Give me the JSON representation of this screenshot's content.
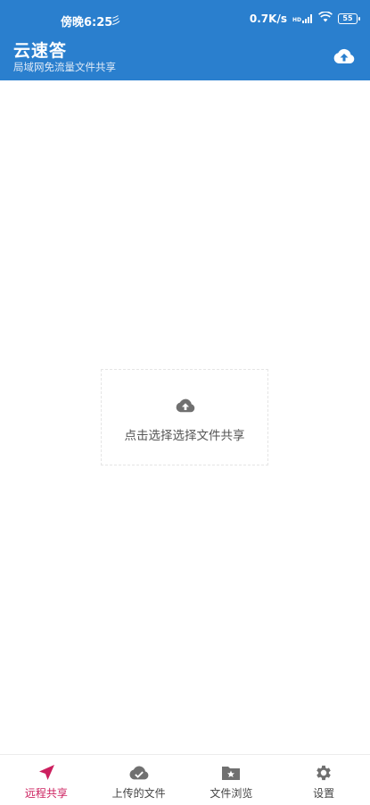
{
  "status_bar": {
    "time": "傍晚6:25",
    "notification_glyph": "彡",
    "network_speed": "0.7K/s",
    "signal_tag": "HD",
    "battery": "55"
  },
  "app_bar": {
    "title": "云速答",
    "subtitle": "局域网免流量文件共享",
    "upload_icon": "cloud-upload-icon"
  },
  "main": {
    "drop_zone_label": "点击选择选择文件共享",
    "drop_zone_icon": "cloud-upload-icon"
  },
  "bottom_nav": {
    "items": [
      {
        "label": "远程共享",
        "icon": "navigation-arrow-icon",
        "active": true
      },
      {
        "label": "上传的文件",
        "icon": "cloud-check-icon",
        "active": false
      },
      {
        "label": "文件浏览",
        "icon": "folder-star-icon",
        "active": false
      },
      {
        "label": "设置",
        "icon": "gear-icon",
        "active": false
      }
    ]
  },
  "colors": {
    "primary": "#2a7fce",
    "accent": "#cc1f5e",
    "icon_gray": "#707070"
  }
}
